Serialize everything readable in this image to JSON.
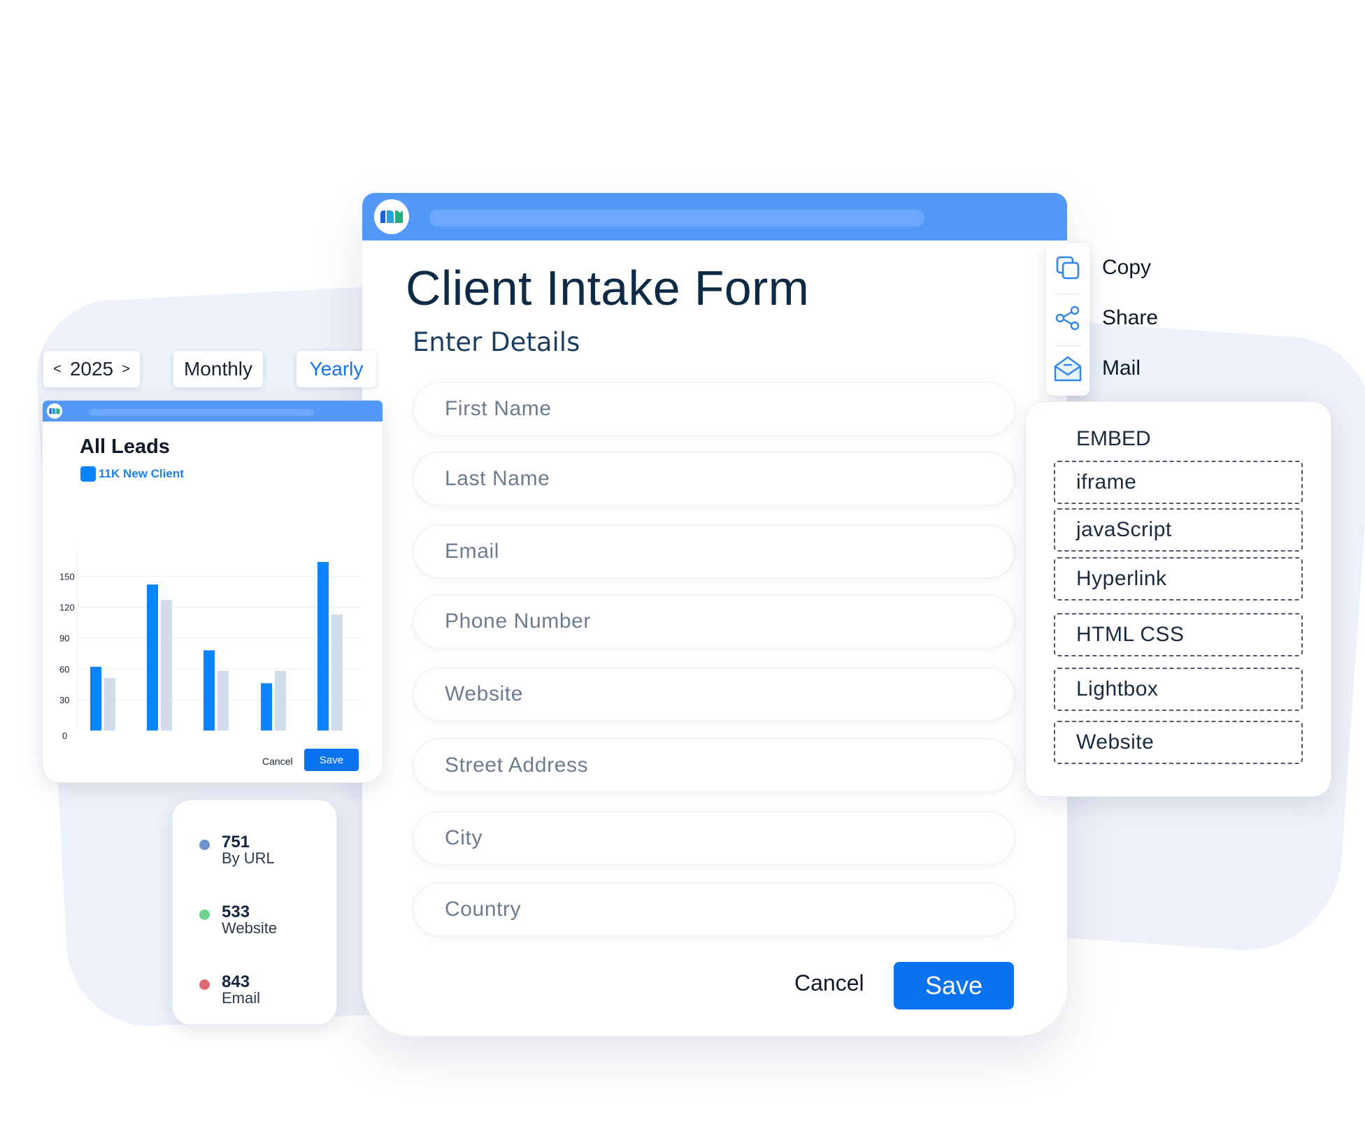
{
  "form": {
    "title": "Client Intake Form",
    "subtitle": "Enter Details",
    "fields": [
      "First Name",
      "Last Name",
      "Email",
      "Phone Number",
      "Website",
      "Street Address",
      "City",
      "Country"
    ],
    "cancel_label": "Cancel",
    "save_label": "Save"
  },
  "share": {
    "copy": "Copy",
    "share": "Share",
    "mail": "Mail"
  },
  "embed": {
    "title": "EMBED",
    "options": [
      "iframe",
      "javaScript",
      "Hyperlink",
      "HTML CSS",
      "Lightbox",
      "Website"
    ]
  },
  "period": {
    "year": "2025",
    "prev": "<",
    "next": ">",
    "monthly": "Monthly",
    "yearly": "Yearly"
  },
  "chart": {
    "title": "All Leads",
    "legend": "11K New Client",
    "cancel_label": "Cancel",
    "save_label": "Save"
  },
  "chart_data": {
    "type": "bar",
    "title": "All Leads",
    "yticks": [
      0,
      30,
      60,
      90,
      120,
      150
    ],
    "ylim": [
      0,
      170
    ],
    "grid": true,
    "series": [
      {
        "name": "11K New Client",
        "color": "#0a84ff",
        "values": [
          62,
          142,
          78,
          46,
          164
        ]
      },
      {
        "color": "#d2dcea",
        "values": [
          51,
          127,
          58,
          58,
          113
        ]
      }
    ]
  },
  "stats": [
    {
      "value": "751",
      "label": "By URL",
      "color": "#6f93cf"
    },
    {
      "value": "533",
      "label": "Website",
      "color": "#6ed68a"
    },
    {
      "value": "843",
      "label": "Email",
      "color": "#dc6b72"
    }
  ],
  "colors": {
    "accent": "#0a73f0",
    "header": "#5299f8",
    "title": "#0f2a44"
  }
}
